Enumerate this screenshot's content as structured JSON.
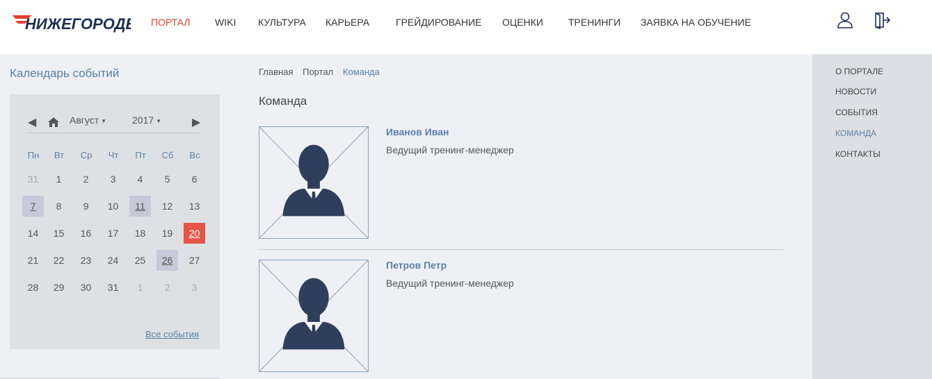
{
  "brand": {
    "logo_text": "НИЖЕГОРОДЕЦ",
    "accent": "#e0402f",
    "link_color": "#5b7fa8"
  },
  "nav": {
    "items": [
      {
        "label": "ПОРТАЛ",
        "active": true
      },
      {
        "label": "WIKI"
      },
      {
        "label": "КУЛЬТУРА"
      },
      {
        "label": "КАРЬЕРА"
      },
      {
        "label": "ГРЕЙДИРОВАНИЕ"
      },
      {
        "label": "ОЦЕНКИ"
      },
      {
        "label": "ТРЕНИНГИ"
      },
      {
        "label": "ЗАЯВКА НА ОБУЧЕНИЕ"
      }
    ]
  },
  "header_icons": [
    "user-icon",
    "logout-icon"
  ],
  "calendar": {
    "title": "Календарь событий",
    "month": "Август",
    "year": "2017",
    "weekdays": [
      "Пн",
      "Вт",
      "Ср",
      "Чт",
      "Пт",
      "Сб",
      "Вс"
    ],
    "weeks": [
      [
        "31",
        "1",
        "2",
        "3",
        "4",
        "5",
        "6"
      ],
      [
        "7",
        "8",
        "9",
        "10",
        "11",
        "12",
        "13"
      ],
      [
        "14",
        "15",
        "16",
        "17",
        "18",
        "19",
        "20"
      ],
      [
        "21",
        "22",
        "23",
        "24",
        "25",
        "26",
        "27"
      ],
      [
        "28",
        "29",
        "30",
        "31",
        "1",
        "2",
        "3"
      ]
    ],
    "event_days": [
      "7",
      "11",
      "26"
    ],
    "today": "20",
    "all_events": "Все события"
  },
  "breadcrumb": [
    "Главная",
    "Портал",
    "Команда"
  ],
  "page_title": "Команда",
  "team": [
    {
      "name": "Иванов Иван",
      "role": "Ведущий тренинг-менеджер"
    },
    {
      "name": "Петров Петр",
      "role": "Ведущий тренинг-менеджер"
    }
  ],
  "side_menu": [
    {
      "label": "О ПОРТАЛЕ"
    },
    {
      "label": "НОВОСТИ"
    },
    {
      "label": "СОБЫТИЯ"
    },
    {
      "label": "КОМАНДА",
      "active": true
    },
    {
      "label": "КОНТАКТЫ"
    }
  ]
}
